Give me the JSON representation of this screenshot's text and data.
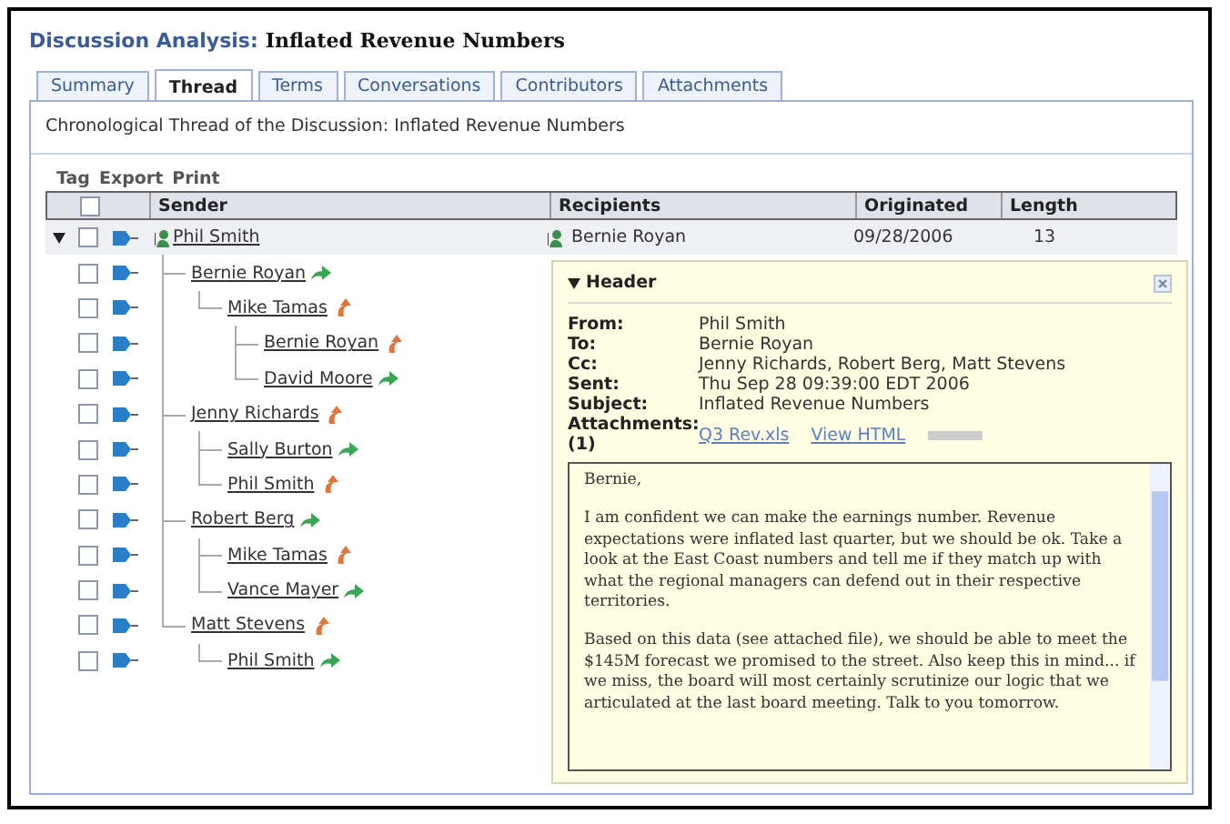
{
  "title": {
    "prefix": "Discussion Analysis:",
    "name": "Inflated Revenue Numbers"
  },
  "tabs": [
    {
      "label": "Summary",
      "selected": false
    },
    {
      "label": "Thread",
      "selected": true
    },
    {
      "label": "Terms",
      "selected": false
    },
    {
      "label": "Conversations",
      "selected": false
    },
    {
      "label": "Contributors",
      "selected": false
    },
    {
      "label": "Attachments",
      "selected": false
    }
  ],
  "subtitle": "Chronological Thread of the Discussion: Inflated Revenue Numbers",
  "actions": [
    "Tag",
    "Export",
    "Print"
  ],
  "table": {
    "select_all_checked": false,
    "columns": [
      "Sender",
      "Recipients",
      "Originated",
      "Length"
    ],
    "thread": {
      "sender": "Phil Smith",
      "kind": "origin",
      "checked": false,
      "expanded": true,
      "recipients": "Bernie Royan",
      "originated": "09/28/2006",
      "length": "13",
      "children": [
        {
          "sender": "Bernie Royan",
          "kind": "reply",
          "checked": false,
          "children": [
            {
              "sender": "Mike Tamas",
              "kind": "forward",
              "checked": false,
              "children": [
                {
                  "sender": "Bernie Royan",
                  "kind": "forward",
                  "checked": false
                },
                {
                  "sender": "David Moore",
                  "kind": "reply",
                  "checked": false
                }
              ]
            }
          ]
        },
        {
          "sender": "Jenny Richards",
          "kind": "forward",
          "checked": false,
          "children": [
            {
              "sender": "Sally Burton",
              "kind": "reply",
              "checked": false
            },
            {
              "sender": "Phil Smith",
              "kind": "forward",
              "checked": false
            }
          ]
        },
        {
          "sender": "Robert Berg",
          "kind": "reply",
          "checked": false,
          "children": [
            {
              "sender": "Mike Tamas",
              "kind": "forward",
              "checked": false
            },
            {
              "sender": "Vance Mayer",
              "kind": "reply",
              "checked": false
            }
          ]
        },
        {
          "sender": "Matt Stevens",
          "kind": "forward",
          "checked": false,
          "children": [
            {
              "sender": "Phil Smith",
              "kind": "reply",
              "checked": false
            }
          ]
        }
      ]
    }
  },
  "header_panel": {
    "title": "Header",
    "expanded": true,
    "fields": [
      {
        "label": "From:",
        "value": "Phil Smith"
      },
      {
        "label": "To:",
        "value": "Bernie Royan"
      },
      {
        "label": "Cc:",
        "value": "Jenny Richards, Robert Berg, Matt Stevens"
      },
      {
        "label": "Sent:",
        "value": "Thu Sep 28 09:39:00 EDT 2006"
      },
      {
        "label": "Subject:",
        "value": "Inflated Revenue Numbers"
      }
    ],
    "attachments": {
      "label": "Attachments:",
      "count": "(1)",
      "links": [
        "Q3 Rev.xls",
        "View HTML"
      ]
    },
    "body": [
      "Bernie,",
      "I am confident we can make the earnings number. Revenue expectations were inflated last quarter, but we should be ok. Take a look at the East Coast numbers and tell me if they match up with what the regional managers can defend out in their respective territories.",
      "Based on this data (see attached file), we should be able to meet the $145M forecast we promised to the street. Also keep this in mind... if we miss, the board will most certainly scrutinize our logic that we articulated at the last board meeting. Talk to you tomorrow."
    ]
  }
}
